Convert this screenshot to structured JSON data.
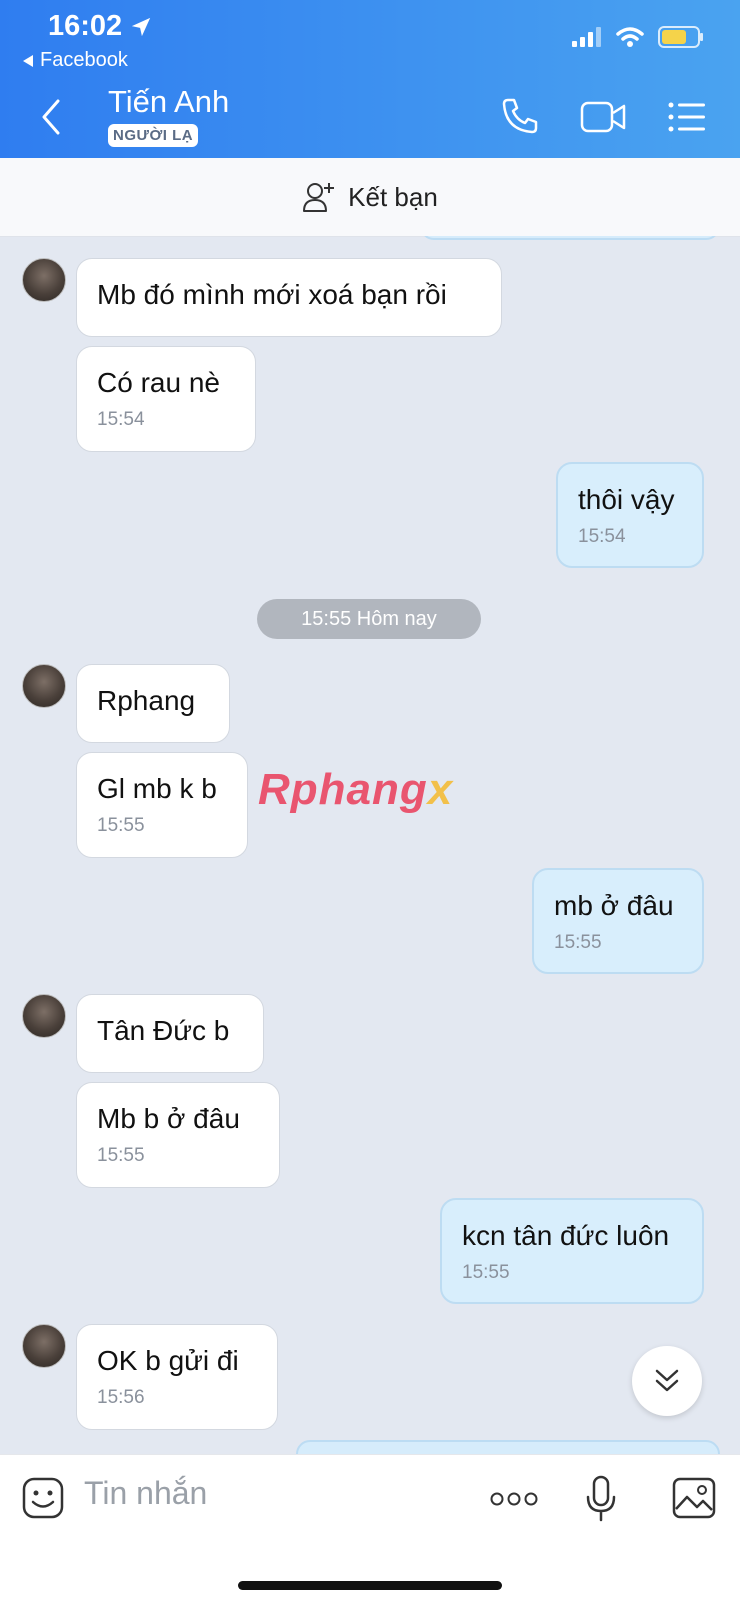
{
  "status_bar": {
    "time": "16:02",
    "back_app": "Facebook"
  },
  "header": {
    "title": "Tiến Anh",
    "badge": "NGƯỜI LẠ"
  },
  "friend_bar": {
    "label": "Kết bạn"
  },
  "messages": [
    {
      "text": "Mb đó mình mới xoá bạn rồi",
      "time": ""
    },
    {
      "text": "Có rau nè",
      "time": "15:54"
    },
    {
      "text": "thôi vậy",
      "time": "15:54"
    },
    {
      "text": "Rphang",
      "time": ""
    },
    {
      "text": "Gl mb k b",
      "time": "15:55"
    },
    {
      "text": "mb ở đâu",
      "time": "15:55"
    },
    {
      "text": "Tân Đức b",
      "time": ""
    },
    {
      "text": "Mb b ở đâu",
      "time": "15:55"
    },
    {
      "text": "kcn tân đức luôn",
      "time": "15:55"
    },
    {
      "text": "OK b gửi đi",
      "time": "15:56"
    }
  ],
  "separator": "15:55 Hôm nay",
  "watermark": {
    "main": "Rphang",
    "accent": "x"
  },
  "input": {
    "placeholder": "Tin nhắn"
  },
  "colors": {
    "header_start": "#2f7df0",
    "header_end": "#4aa3f0",
    "outgoing_bubble": "#d8eefc",
    "chat_bg": "#e3e8f1"
  }
}
